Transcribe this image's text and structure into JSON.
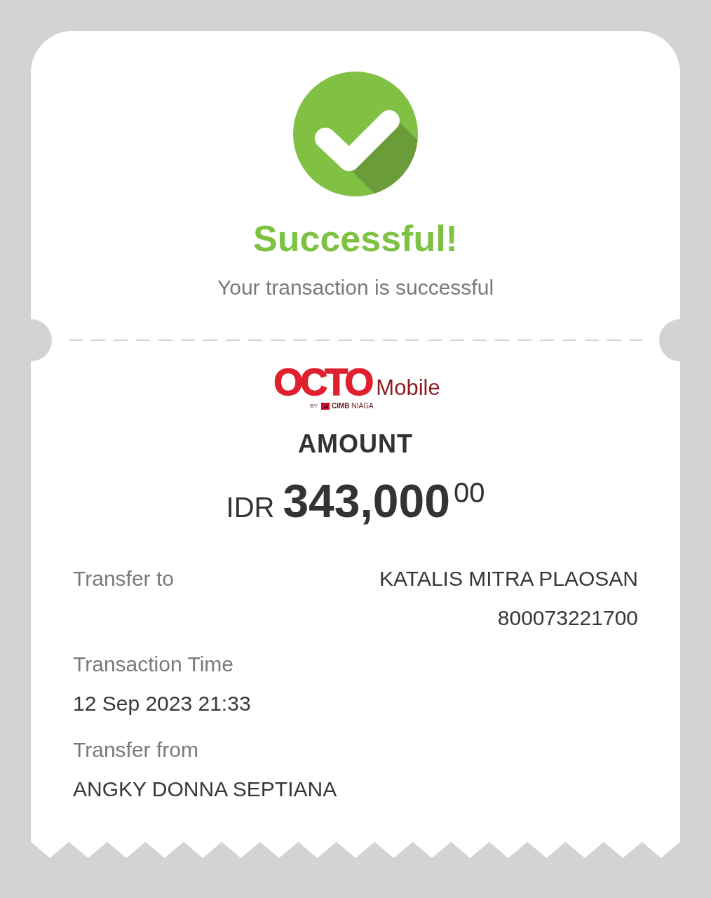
{
  "status": {
    "kind": "success",
    "title": "Successful!",
    "message": "Your transaction is successful"
  },
  "logo": {
    "wordmark": "OCTO",
    "product": "Mobile",
    "by": "BY",
    "bank": "CIMB",
    "bank_suffix": "NIAGA"
  },
  "amount": {
    "label": "AMOUNT",
    "currency": "IDR",
    "value": "343,000",
    "decimals": "00"
  },
  "details": [
    {
      "kind": "inline",
      "label": "Transfer to",
      "values": [
        "KATALIS MITRA PLAOSAN",
        "800073221700"
      ]
    },
    {
      "kind": "stacked",
      "label": "Transaction Time",
      "values": [
        "12 Sep 2023 21:33"
      ]
    },
    {
      "kind": "stacked",
      "label": "Transfer from",
      "values": [
        "ANGKY DONNA SEPTIANA"
      ]
    }
  ]
}
